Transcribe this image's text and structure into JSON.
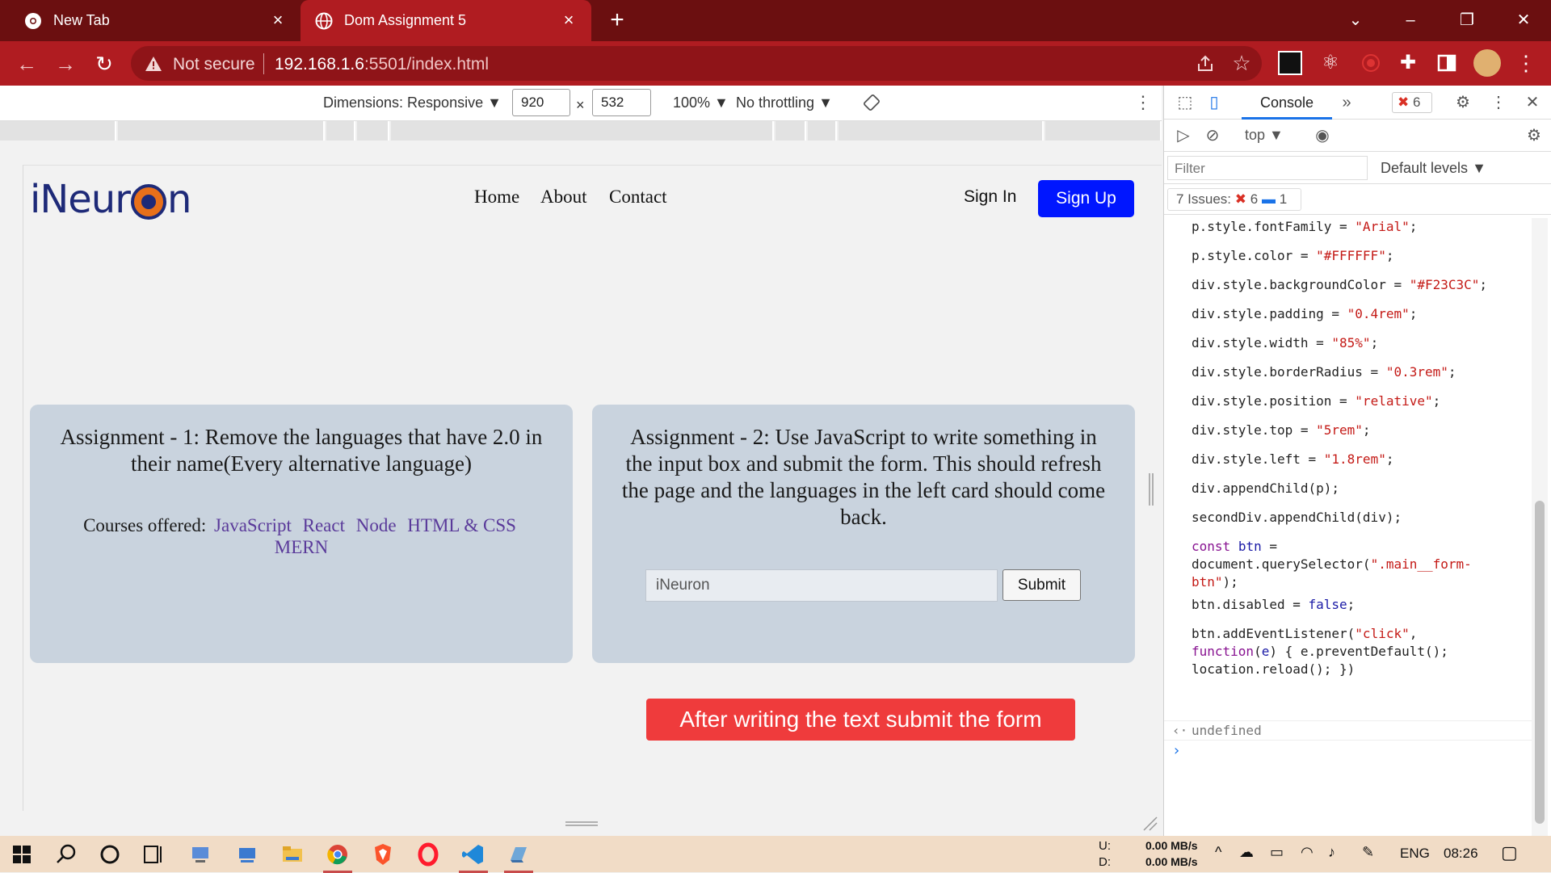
{
  "browser": {
    "tabs": [
      {
        "title": "New Tab"
      },
      {
        "title": "Dom Assignment 5"
      }
    ],
    "omnibox": {
      "security": "Not secure",
      "host": "192.168.1.6",
      "path": ":5501/index.html"
    }
  },
  "device_toolbar": {
    "dimensions_label": "Dimensions: Responsive",
    "width_value": "920",
    "times": "×",
    "height_value": "532",
    "zoom": "100%",
    "throttling": "No throttling"
  },
  "page": {
    "logo_prefix": "iNeur",
    "logo_suffix": "n",
    "nav": [
      "Home",
      "About",
      "Contact"
    ],
    "sign_in": "Sign In",
    "sign_up": "Sign Up",
    "card1": {
      "title": "Assignment - 1: Remove the languages that have 2.0 in their name(Every alternative language)",
      "courses_label": "Courses offered:",
      "languages": [
        "JavaScript",
        "React",
        "Node",
        "HTML & CSS",
        "MERN"
      ]
    },
    "card2": {
      "title": "Assignment - 2: Use JavaScript to write something in the input box and submit the form. This should refresh the page and the languages in the left card should come back.",
      "input_value": "iNeuron",
      "submit_label": "Submit"
    },
    "banner": "After writing the text submit the form"
  },
  "devtools": {
    "console_tab": "Console",
    "error_count": "6",
    "context": "top",
    "filter_placeholder": "Filter",
    "levels": "Default levels",
    "issues_label": "7 Issues:",
    "issues_errors": "6",
    "issues_info": "1",
    "result": "undefined"
  },
  "taskbar": {
    "net_up_label": "U:",
    "net_down_label": "D:",
    "net_up": "0.00 MB/s",
    "net_down": "0.00 MB/s",
    "lang": "ENG",
    "time": "08:26"
  },
  "colors": {
    "tabstrip": "#6b0f10",
    "toolbar": "#b01c21",
    "signup": "#0016ff",
    "banner": "#ef3b3c",
    "card": "#c9d3de"
  }
}
